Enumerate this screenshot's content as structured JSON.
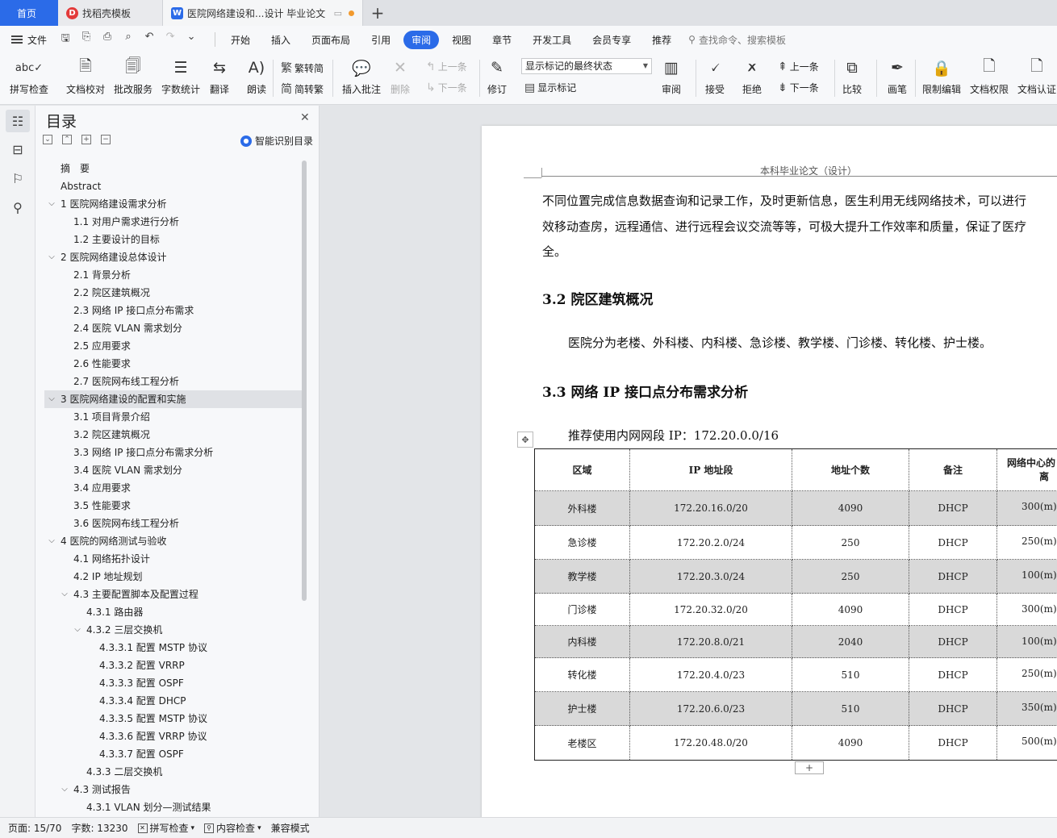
{
  "tabs": {
    "home": "首页",
    "template_tab": "找稻壳模板",
    "doc_tab": "医院网络建设和...设计 毕业论文",
    "add_icon": "plus-icon"
  },
  "menu": {
    "file": "文件",
    "items": [
      "开始",
      "插入",
      "页面布局",
      "引用",
      "审阅",
      "视图",
      "章节",
      "开发工具",
      "会员专享",
      "推荐"
    ],
    "active": "审阅",
    "search": "查找命令、搜索模板"
  },
  "ribbon": {
    "spell": "拼写检查",
    "proof": "文档校对",
    "revise_service": "批改服务",
    "word_count": "字数统计",
    "translate": "翻译",
    "read_aloud": "朗读",
    "to_traditional": "繁转简",
    "to_simplified": "简转繁",
    "insert_comment": "插入批注",
    "delete": "删除",
    "prev": "上一条",
    "next": "下一条",
    "revise": "修订",
    "markup_state": "显示标记的最终状态",
    "show_markup": "显示标记",
    "review": "审阅",
    "accept": "接受",
    "reject": "拒绝",
    "prev2": "上一条",
    "next2": "下一条",
    "compare": "比较",
    "pen": "画笔",
    "restrict": "限制编辑",
    "permission": "文档权限",
    "certify": "文档认证"
  },
  "toc": {
    "title": "目录",
    "smart": "智能识别目录",
    "items": [
      {
        "label": "摘　要",
        "level": 1,
        "chev": ""
      },
      {
        "label": "Abstract",
        "level": 1,
        "chev": ""
      },
      {
        "label": "1 医院网络建设需求分析",
        "level": 1,
        "chev": "v"
      },
      {
        "label": "1.1 对用户需求进行分析",
        "level": 2,
        "chev": ""
      },
      {
        "label": "1.2 主要设计的目标",
        "level": 2,
        "chev": ""
      },
      {
        "label": "2 医院网络建设总体设计",
        "level": 1,
        "chev": "v"
      },
      {
        "label": "2.1 背景分析",
        "level": 2,
        "chev": ""
      },
      {
        "label": "2.2 院区建筑概况",
        "level": 2,
        "chev": ""
      },
      {
        "label": "2.3 网络 IP 接口点分布需求",
        "level": 2,
        "chev": ""
      },
      {
        "label": "2.4 医院 VLAN 需求划分",
        "level": 2,
        "chev": ""
      },
      {
        "label": "2.5 应用要求",
        "level": 2,
        "chev": ""
      },
      {
        "label": "2.6 性能要求",
        "level": 2,
        "chev": ""
      },
      {
        "label": "2.7 医院网布线工程分析",
        "level": 2,
        "chev": ""
      },
      {
        "label": "3 医院网络建设的配置和实施",
        "level": 1,
        "chev": "v",
        "selected": true
      },
      {
        "label": "3.1 项目背景介绍",
        "level": 2,
        "chev": ""
      },
      {
        "label": "3.2 院区建筑概况",
        "level": 2,
        "chev": ""
      },
      {
        "label": "3.3 网络 IP 接口点分布需求分析",
        "level": 2,
        "chev": ""
      },
      {
        "label": "3.4 医院 VLAN 需求划分",
        "level": 2,
        "chev": ""
      },
      {
        "label": "3.4 应用要求",
        "level": 2,
        "chev": ""
      },
      {
        "label": "3.5 性能要求",
        "level": 2,
        "chev": ""
      },
      {
        "label": "3.6 医院网布线工程分析",
        "level": 2,
        "chev": ""
      },
      {
        "label": "4 医院的网络测试与验收",
        "level": 1,
        "chev": "v"
      },
      {
        "label": "4.1 网络拓扑设计",
        "level": 2,
        "chev": ""
      },
      {
        "label": "4.2 IP 地址规划",
        "level": 2,
        "chev": ""
      },
      {
        "label": "4.3 主要配置脚本及配置过程",
        "level": 2,
        "chev": "v"
      },
      {
        "label": "4.3.1 路由器",
        "level": 3,
        "chev": ""
      },
      {
        "label": "4.3.2 三层交换机",
        "level": 3,
        "chev": "v"
      },
      {
        "label": "4.3.3.1 配置 MSTP 协议",
        "level": 4,
        "chev": ""
      },
      {
        "label": "4.3.3.2 配置 VRRP",
        "level": 4,
        "chev": ""
      },
      {
        "label": "4.3.3.3 配置 OSPF",
        "level": 4,
        "chev": ""
      },
      {
        "label": "4.3.3.4 配置 DHCP",
        "level": 4,
        "chev": ""
      },
      {
        "label": "4.3.3.5 配置 MSTP 协议",
        "level": 4,
        "chev": ""
      },
      {
        "label": "4.3.3.6 配置 VRRP 协议",
        "level": 4,
        "chev": ""
      },
      {
        "label": "4.3.3.7 配置 OSPF",
        "level": 4,
        "chev": ""
      },
      {
        "label": "4.3.3 二层交换机",
        "level": 3,
        "chev": ""
      },
      {
        "label": "4.3 测试报告",
        "level": 2,
        "chev": "v"
      },
      {
        "label": "4.3.1 VLAN 划分—测试结果",
        "level": 3,
        "chev": ""
      }
    ]
  },
  "doc": {
    "header": "本科毕业论文（设计）",
    "para1_line1": "不同位置完成信息数据查询和记录工作，及时更新信息，医生利用无线网络技术，可以进行",
    "para1_line2": "效移动查房，远程通信、进行远程会议交流等等，可极大提升工作效率和质量，保证了医疗",
    "para1_line3": "全。",
    "h_3_2": "3.2 院区建筑概况",
    "para2": "医院分为老楼、外科楼、内科楼、急诊楼、教学楼、门诊楼、转化楼、护士楼。",
    "h_3_3": "3.3 网络 IP 接口点分布需求分析",
    "para3": "推荐使用内网网段 IP：172.20.0.0/16",
    "table": {
      "headers": [
        "区域",
        "IP 地址段",
        "地址个数",
        "备注",
        "网络中心的距离"
      ],
      "header_last_line1": "网络中心的",
      "header_last_line2": "离",
      "rows": [
        {
          "area": "外科楼",
          "ip": "172.20.16.0/20",
          "count": "4090",
          "note": "DHCP",
          "dist": "300(m)",
          "shade": true
        },
        {
          "area": "急诊楼",
          "ip": "172.20.2.0/24",
          "count": "250",
          "note": "DHCP",
          "dist": "250(m)",
          "shade": false
        },
        {
          "area": "教学楼",
          "ip": "172.20.3.0/24",
          "count": "250",
          "note": "DHCP",
          "dist": "100(m)",
          "shade": true
        },
        {
          "area": "门诊楼",
          "ip": "172.20.32.0/20",
          "count": "4090",
          "note": "DHCP",
          "dist": "300(m)",
          "shade": false
        },
        {
          "area": "内科楼",
          "ip": "172.20.8.0/21",
          "count": "2040",
          "note": "DHCP",
          "dist": "100(m)",
          "shade": true
        },
        {
          "area": "转化楼",
          "ip": "172.20.4.0/23",
          "count": "510",
          "note": "DHCP",
          "dist": "250(m)",
          "shade": false
        },
        {
          "area": "护士楼",
          "ip": "172.20.6.0/23",
          "count": "510",
          "note": "DHCP",
          "dist": "350(m)",
          "shade": true
        },
        {
          "area": "老楼区",
          "ip": "172.20.48.0/20",
          "count": "4090",
          "note": "DHCP",
          "dist": "500(m)",
          "shade": false
        }
      ]
    }
  },
  "status": {
    "page": "页面: 15/70",
    "words": "字数: 13230",
    "spell": "拼写检查",
    "content": "内容检查",
    "compat": "兼容模式"
  },
  "colors": {
    "accent": "#2b6be8",
    "table_shade": "#d9d9d9"
  }
}
